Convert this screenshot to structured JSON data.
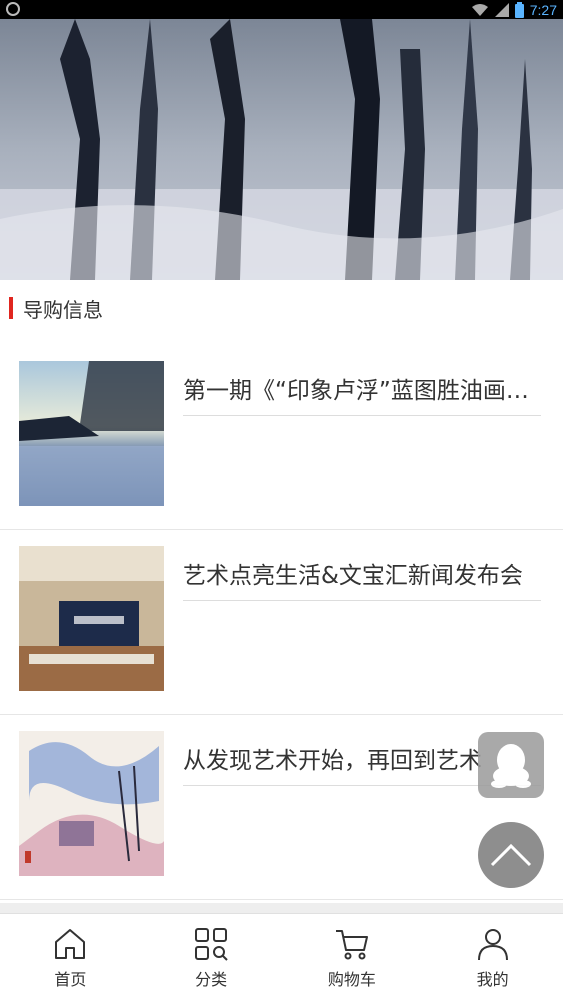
{
  "status_bar": {
    "time": "7:27"
  },
  "section": {
    "title": "导购信息"
  },
  "articles": [
    {
      "title": "第一期《“印象卢浮”蓝图胜油画艺术展》"
    },
    {
      "title": "艺术点亮生活&文宝汇新闻发布会"
    },
    {
      "title": "从发现艺术开始，再回到艺术"
    }
  ],
  "tabbar": {
    "home": "首页",
    "category": "分类",
    "cart": "购物车",
    "mine": "我的"
  },
  "colors": {
    "accent": "#e0261f",
    "text": "#333333",
    "time": "#5ab4ff"
  }
}
